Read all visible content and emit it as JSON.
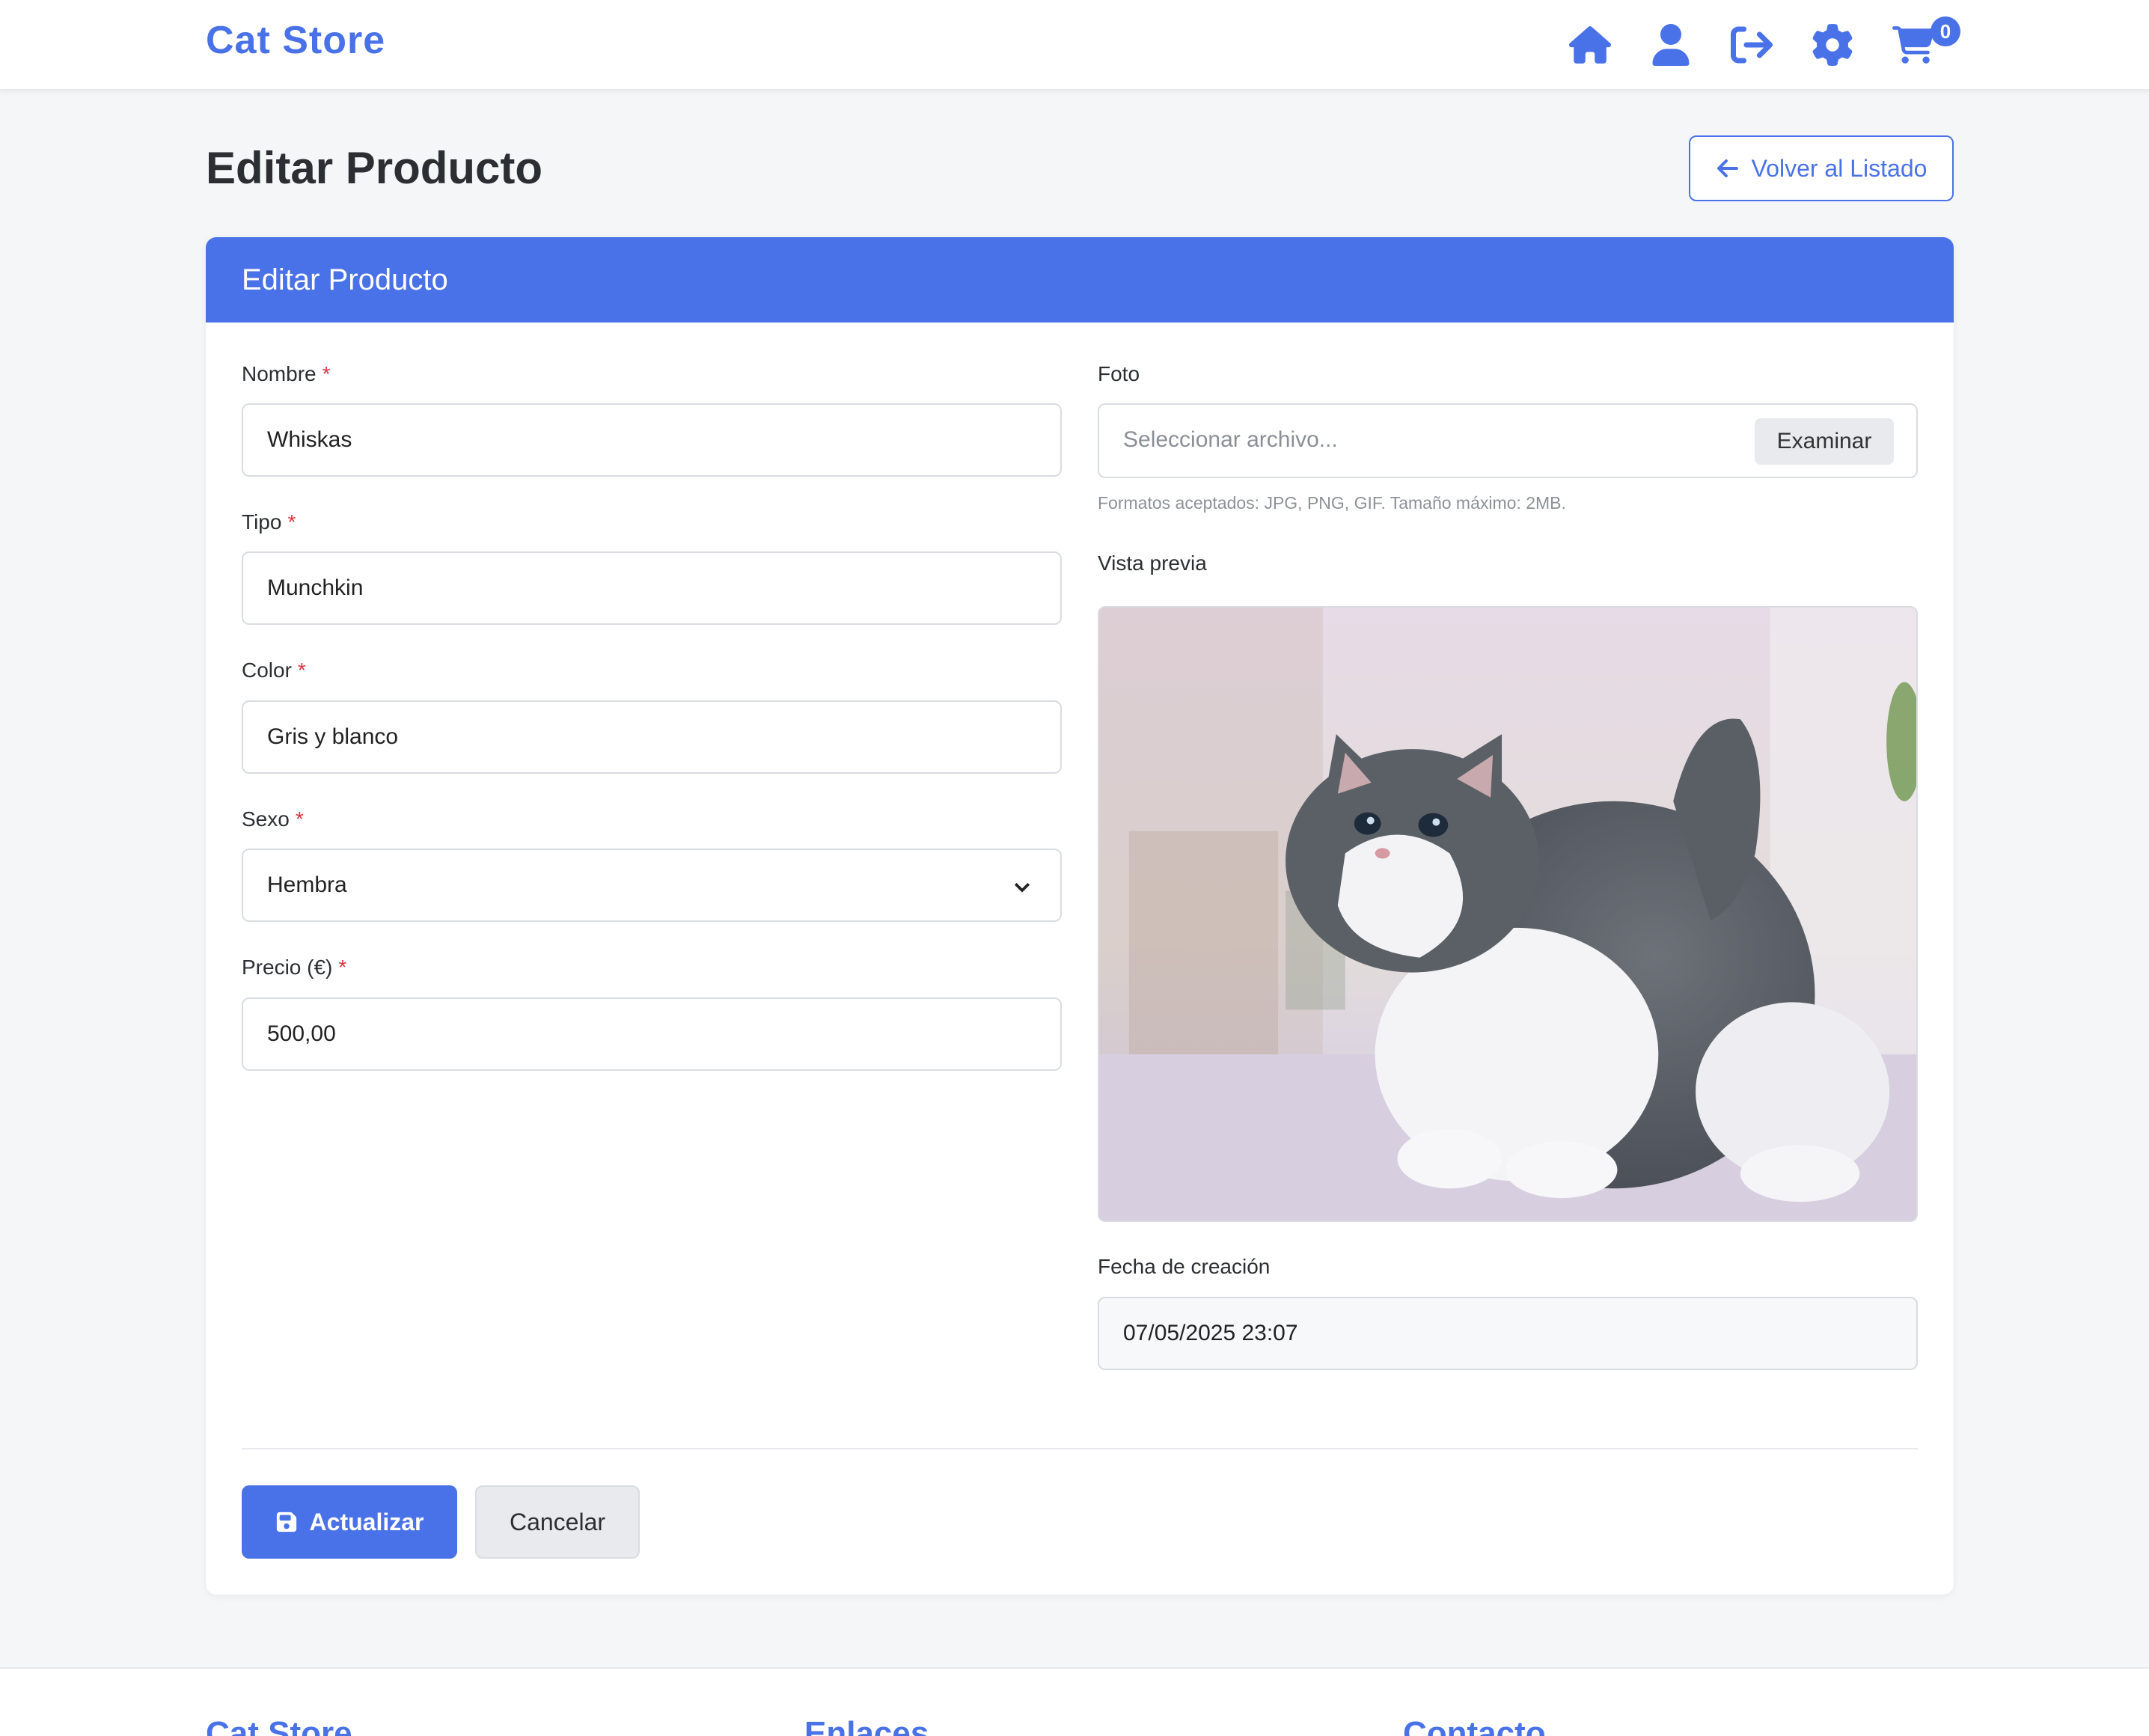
{
  "navbar": {
    "brand": "Cat Store",
    "icons": [
      "home-icon",
      "user-icon",
      "logout-icon",
      "gear-icon",
      "cart-icon"
    ],
    "cart_count": "0"
  },
  "page": {
    "title": "Editar Producto",
    "back_button": "Volver al Listado"
  },
  "card": {
    "header": "Editar Producto",
    "required_mark": "*",
    "fields": {
      "nombre": {
        "label": "Nombre",
        "value": "Whiskas"
      },
      "tipo": {
        "label": "Tipo",
        "value": "Munchkin"
      },
      "color": {
        "label": "Color",
        "value": "Gris y blanco"
      },
      "sexo": {
        "label": "Sexo",
        "value": "Hembra"
      },
      "precio": {
        "label": "Precio (€)",
        "value": "500,00"
      }
    },
    "foto": {
      "label": "Foto",
      "placeholder": "Seleccionar archivo...",
      "browse_button": "Examinar",
      "help": "Formatos aceptados: JPG, PNG, GIF. Tamaño máximo: 2MB."
    },
    "preview": {
      "label": "Vista previa"
    },
    "fecha": {
      "label": "Fecha de creación",
      "value": "07/05/2025 23:07"
    },
    "actions": {
      "submit": "Actualizar",
      "cancel": "Cancelar"
    }
  },
  "footer": {
    "columns": [
      "Cat Store",
      "Enlaces",
      "Contacto"
    ]
  },
  "colors": {
    "accent": "#4a72e8",
    "required": "#d9363e",
    "background": "#f5f6f8"
  }
}
